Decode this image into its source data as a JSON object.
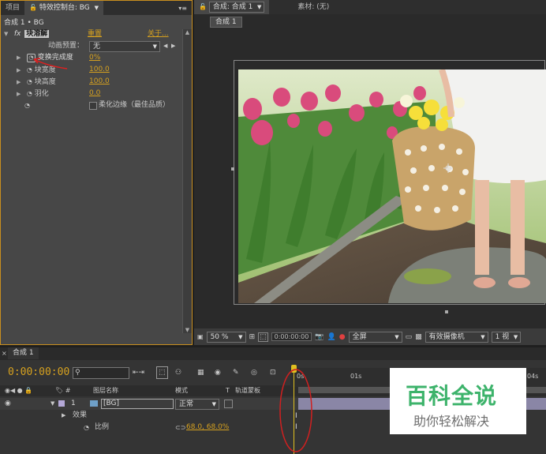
{
  "left_panel": {
    "tabs": [
      "项目",
      "特效控制台: BG"
    ],
    "breadcrumb": "合成 1 • BG",
    "effect": {
      "name": "块溶解",
      "reset": "重置",
      "about": "关于...",
      "preset_label": "动画预置：",
      "preset_value": "无",
      "props": [
        {
          "name": "变换完成度",
          "value": "0%"
        },
        {
          "name": "块宽度",
          "value": "100.0"
        },
        {
          "name": "块高度",
          "value": "100.0"
        },
        {
          "name": "羽化",
          "value": "0.0"
        }
      ],
      "soft_edges": "柔化边缘（最佳品质）"
    }
  },
  "viewer": {
    "comp_tab": "合成: 合成 1",
    "footage_tab": "素材: (无)",
    "comp_chip": "合成 1",
    "zoom": "50 %",
    "timecode": "0:00:00:00",
    "resolution": "全屏",
    "camera": "有效摄像机",
    "views": "1 视"
  },
  "timeline": {
    "tab": "合成 1",
    "timecode": "0:00:00:00",
    "col_name": "图层名称",
    "col_mode": "模式",
    "col_t": "T",
    "col_trkmat": "轨道蒙板",
    "layer_num": "1",
    "layer_name": "[BG]",
    "layer_mode": "正常",
    "effects_label": "效果",
    "scale_label": "比例",
    "scale_value": "68.0, 68.0%",
    "ruler": [
      "0s",
      "01s",
      "04s"
    ]
  },
  "watermark": {
    "title": "百科全说",
    "subtitle": "助你轻松解决"
  },
  "colors": {
    "highlight": "#c98f1f",
    "value_orange": "#d6a11f",
    "watermark_green": "#3db36b"
  }
}
